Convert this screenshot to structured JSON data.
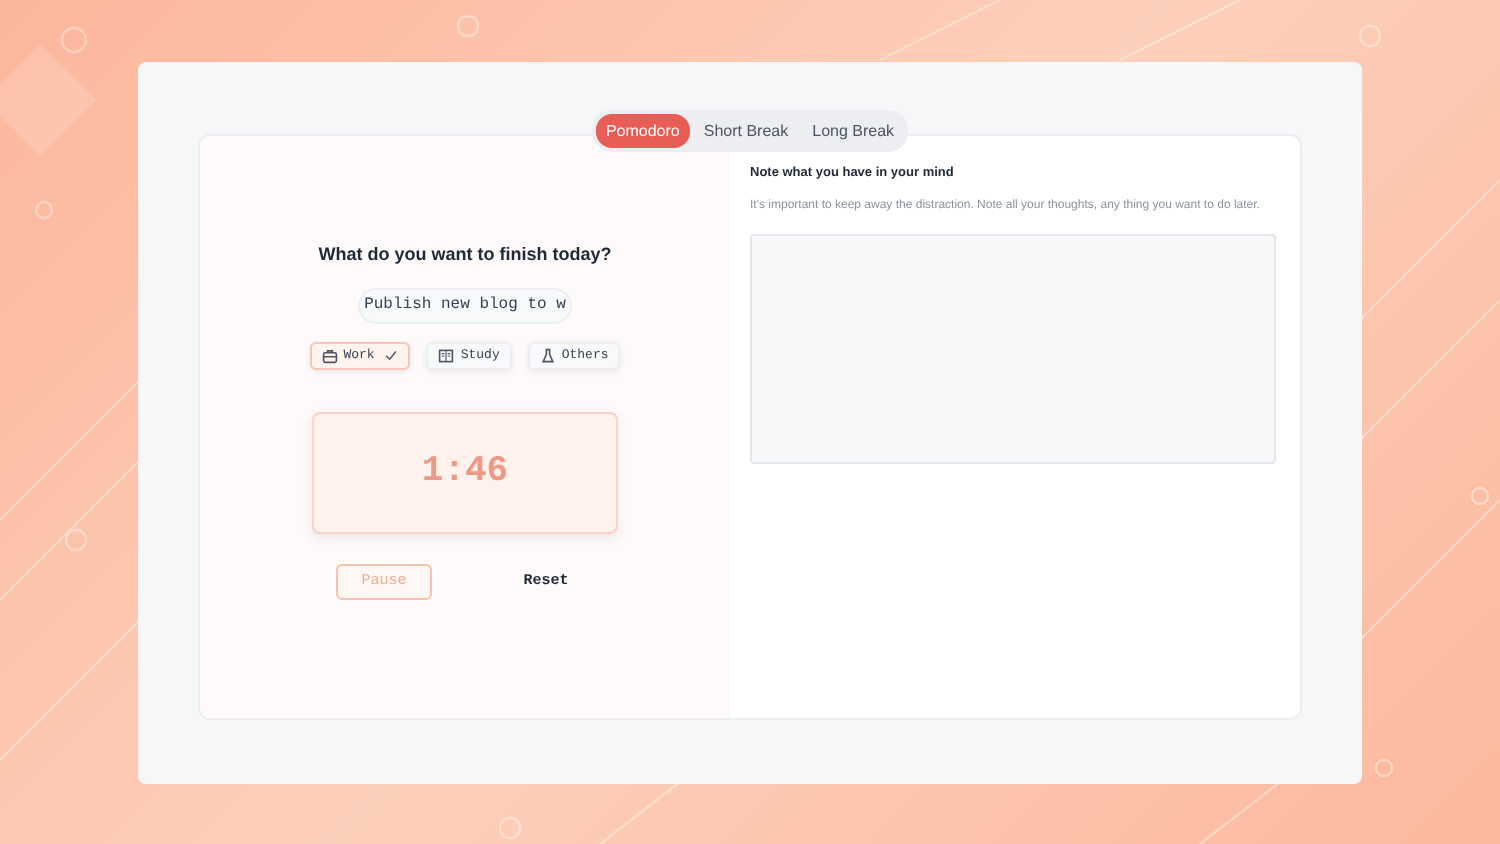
{
  "tabs": [
    {
      "label": "Pomodoro",
      "selected": true
    },
    {
      "label": "Short Break",
      "selected": false
    },
    {
      "label": "Long Break",
      "selected": false
    }
  ],
  "task": {
    "heading": "What do you want to finish today?",
    "value": "Publish new blog to w"
  },
  "categories": [
    {
      "label": "Work",
      "kind": "briefcase",
      "selected": true
    },
    {
      "label": "Study",
      "kind": "book",
      "selected": false
    },
    {
      "label": "Others",
      "kind": "flask",
      "selected": false
    }
  ],
  "timer": {
    "reading": "1:46"
  },
  "buttons": [
    {
      "label": "Pause",
      "kind": "outline"
    },
    {
      "label": "Reset",
      "kind": "plain"
    }
  ],
  "notes": {
    "title": "Note what you have in your mind",
    "description": "It's important to keep away the distraction. Note all your thoughts, any thing you want to do later."
  }
}
